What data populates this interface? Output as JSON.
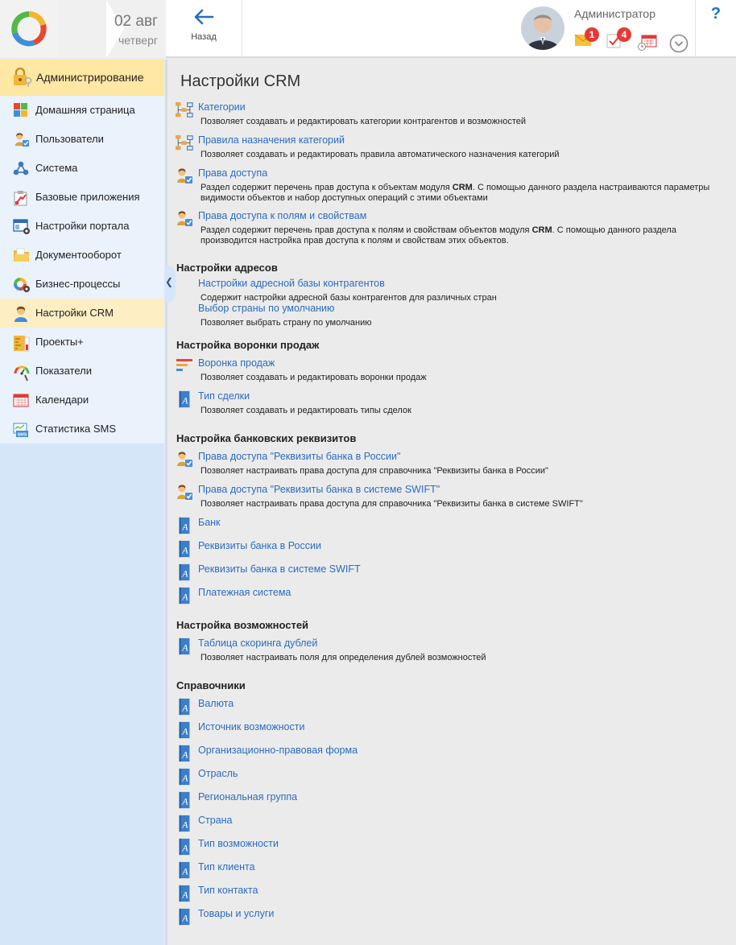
{
  "header": {
    "date": "02 авг",
    "weekday": "четверг",
    "back_label": "Назад",
    "user_name": "Администратор",
    "mail_count": "1",
    "tasks_count": "4",
    "help": "?"
  },
  "sidebar": {
    "section_title": "Администрирование",
    "items": [
      {
        "label": "Домашняя страница",
        "icon": "home-grid-icon"
      },
      {
        "label": "Пользователи",
        "icon": "users-icon"
      },
      {
        "label": "Система",
        "icon": "system-share-icon"
      },
      {
        "label": "Базовые приложения",
        "icon": "base-apps-icon"
      },
      {
        "label": "Настройки портала",
        "icon": "portal-settings-icon"
      },
      {
        "label": "Документооборот",
        "icon": "folder-icon"
      },
      {
        "label": "Бизнес-процессы",
        "icon": "business-process-icon"
      },
      {
        "label": "Настройки CRM",
        "icon": "crm-user-icon"
      },
      {
        "label": "Проекты+",
        "icon": "projects-icon"
      },
      {
        "label": "Показатели",
        "icon": "gauge-icon"
      },
      {
        "label": "Календари",
        "icon": "calendar-icon"
      },
      {
        "label": "Статистика SMS",
        "icon": "sms-icon"
      }
    ]
  },
  "page": {
    "title": "Настройки CRM",
    "top_items": [
      {
        "link": "Категории",
        "desc": "Позволяет создавать и редактировать категории контрагентов и возможностей"
      },
      {
        "link": "Правила назначения категорий",
        "desc": "Позволяет создавать и редактировать правила автоматического назначения категорий"
      },
      {
        "link": "Права доступа",
        "desc": "Раздел содержит перечень прав доступа к объектам модуля CRM. С помощью данного раздела настраиваются параметры видимости объектов и набор доступных операций с этими объектами"
      },
      {
        "link": "Права доступа к полям и свойствам",
        "desc": "Раздел содержит перечень прав доступа к полям и свойствам объектов модуля CRM. С помощью данного раздела производится настройка прав доступа к полям и свойствам этих объектов."
      }
    ],
    "address_section": {
      "title": "Настройки адресов",
      "items": [
        {
          "link": "Настройки адресной базы контрагентов",
          "desc": "Содержит настройки адресной базы контрагентов для различных стран"
        },
        {
          "link": "Выбор страны по умолчанию",
          "desc": "Позволяет выбрать страну по умолчанию"
        }
      ]
    },
    "funnel_section": {
      "title": "Настройка воронки продаж",
      "items": [
        {
          "link": "Воронка продаж",
          "desc": "Позволяет создавать и редактировать воронки продаж"
        },
        {
          "link": "Тип сделки",
          "desc": "Позволяет создавать и редактировать типы сделок"
        }
      ]
    },
    "bank_section": {
      "title": "Настройка банковских реквизитов",
      "items": [
        {
          "link": "Права доступа \"Реквизиты банка в России\"",
          "desc": "Позволяет настраивать права доступа для справочника \"Реквизиты банка в России\""
        },
        {
          "link": "Права доступа \"Реквизиты банка в системе SWIFT\"",
          "desc": "Позволяет настраивать права доступа для справочника \"Реквизиты банка в системе SWIFT\""
        },
        {
          "link": "Банк"
        },
        {
          "link": "Реквизиты банка в России"
        },
        {
          "link": "Реквизиты банка в системе SWIFT"
        },
        {
          "link": "Платежная система"
        }
      ]
    },
    "opportunity_section": {
      "title": "Настройка возможностей",
      "items": [
        {
          "link": "Таблица скоринга дублей",
          "desc": "Позволяет настраивать поля для определения дублей возможностей"
        }
      ]
    },
    "dict_section": {
      "title": "Справочники",
      "items": [
        {
          "link": "Валюта"
        },
        {
          "link": "Источник возможности"
        },
        {
          "link": "Организационно-правовая форма"
        },
        {
          "link": "Отрасль"
        },
        {
          "link": "Региональная группа"
        },
        {
          "link": "Страна"
        },
        {
          "link": "Тип возможности"
        },
        {
          "link": "Тип клиента"
        },
        {
          "link": "Тип контакта"
        },
        {
          "link": "Товары и услуги"
        }
      ]
    }
  },
  "colors": {
    "link": "#2b6cc0",
    "sidebar_bg": "#d6e6f9",
    "menu_bg": "#eaf2fc",
    "active_bg": "#fdeec4",
    "section_header_bg": "#ffe7a4",
    "badge": "#e53935"
  }
}
